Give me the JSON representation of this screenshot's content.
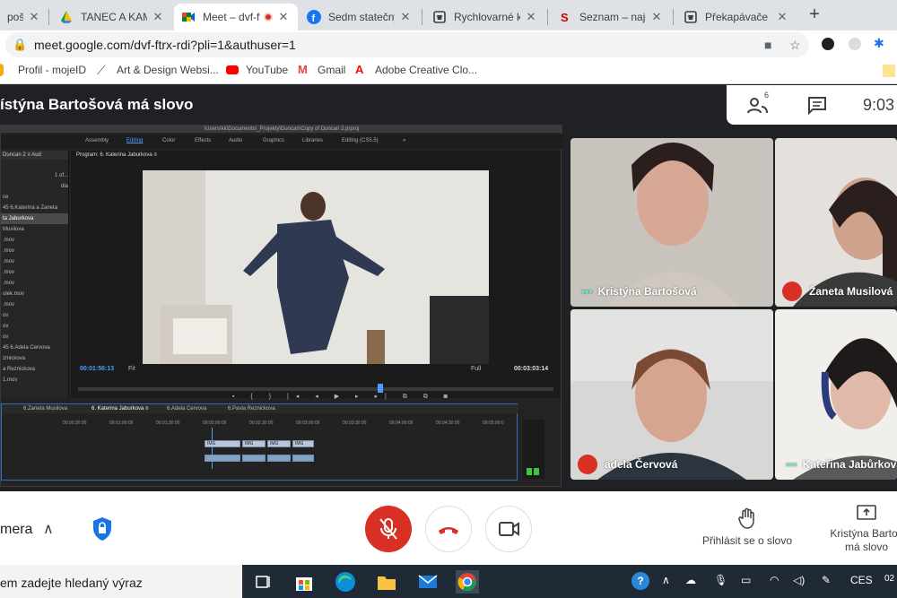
{
  "browser": {
    "tabs": [
      {
        "label": "pošta",
        "active": false
      },
      {
        "label": "TANEC A KAMERA",
        "active": false
      },
      {
        "label": "Meet – dvf-ftrx-rdi",
        "active": true
      },
      {
        "label": "Sedm statečných",
        "active": false
      },
      {
        "label": "Rychlovarné kon",
        "active": false
      },
      {
        "label": "Seznam – najdu",
        "active": false
      },
      {
        "label": "Překapávače ká",
        "active": false
      }
    ],
    "url": "meet.google.com/dvf-ftrx-rdi?pli=1&authuser=1",
    "bookmarks": [
      "Profil - mojeID",
      "Art & Design Websi...",
      "YouTube",
      "Gmail",
      "Adobe Creative Clo..."
    ]
  },
  "meet": {
    "speaker_banner": "ístýna Bartošová má slovo",
    "participant_count": "6",
    "clock": "9:03",
    "participants": [
      {
        "name": "Kristýna Bartošová",
        "muted": false
      },
      {
        "name": "Žaneta Musilová",
        "muted": true
      },
      {
        "name": "adela Červová",
        "muted": true
      },
      {
        "name": "Kateřina Jabůrková",
        "muted": false
      }
    ],
    "controls": {
      "camera_label": "mera",
      "raise_hand": "Přihlásit se o slovo",
      "presenting_line1": "Kristýna Bartoš",
      "presenting_line2": "má slovo"
    }
  },
  "premiere": {
    "path": "\\Users\\kk\\Documents\\_Projekty\\Duncan\\Copy of Duncan 2.prproj",
    "workspaces": [
      "Assembly",
      "Editing",
      "Color",
      "Effects",
      "Audio",
      "Graphics",
      "Libraries",
      "Editing (CS5.5)"
    ],
    "project_tabs": "Duncan 2  ≡   Aud",
    "program_title": "Program: 6. Katerina Jaburkova  ≡",
    "project_items": [
      "",
      "1 of...",
      "dia",
      "ce",
      "45 6.Katerina a Zaneta",
      "ta Jaburkova",
      "Musilova",
      ".mov",
      ".mov",
      ".mov",
      ".mov",
      ".mov",
      "olek.mov",
      ".mov",
      "ov",
      "ov",
      "ov",
      "45 6.Adela Cervova",
      "zmickova",
      "a Reznickova",
      "1.mov"
    ],
    "timecode_current": "00:01:56:13",
    "fit": "Fit",
    "full": "Full",
    "timecode_total": "00:03:03:14",
    "sequence_tabs": [
      "6.Zaneta Musilova",
      "6. Katerina Jaburkova  ≡",
      "6.Adela Cervova",
      "6.Pavla Reznickova"
    ],
    "ruler": [
      "00:00:30:00",
      "00:01:00:00",
      "00:01:30:00",
      "00:02:00:00",
      "00:02:30:00",
      "00:03:00:00",
      "00:03:30:00",
      "00:04:00:00",
      "00:04:30:00",
      "00:05:00:0"
    ],
    "clip_label": "IMG"
  },
  "taskbar": {
    "search_text": "em zadejte hledaný výraz",
    "lang": "CES",
    "time_fragment": "02"
  }
}
